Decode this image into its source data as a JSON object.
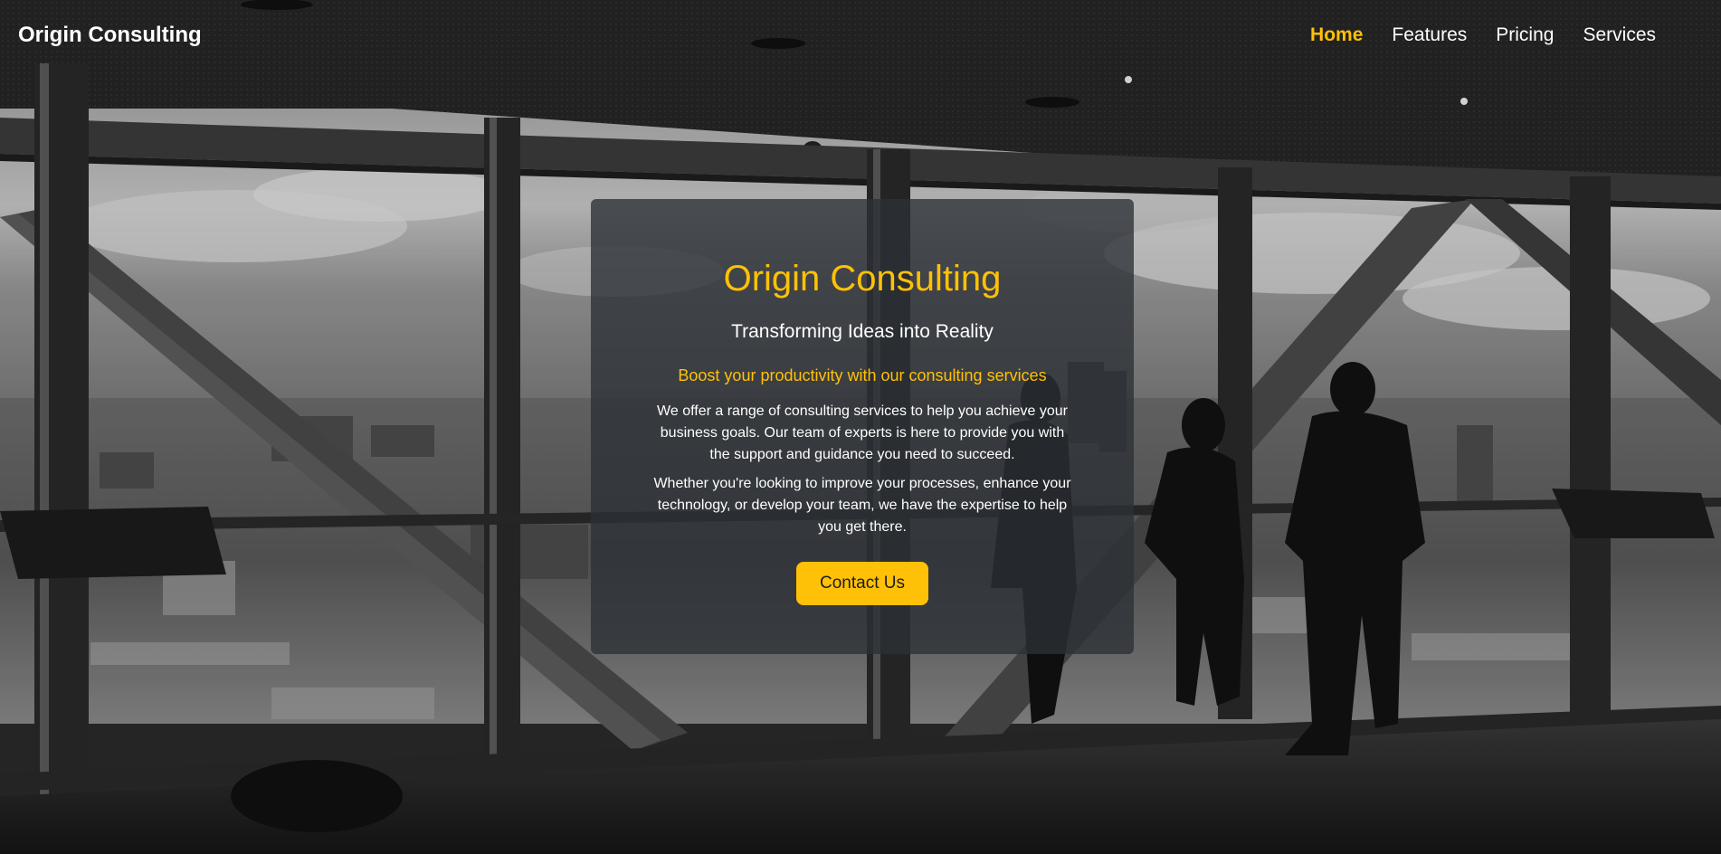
{
  "nav": {
    "brand": "Origin Consulting",
    "links": [
      {
        "label": "Home",
        "active": true
      },
      {
        "label": "Features",
        "active": false
      },
      {
        "label": "Pricing",
        "active": false
      },
      {
        "label": "Services",
        "active": false
      }
    ]
  },
  "hero": {
    "title": "Origin Consulting",
    "subtitle": "Transforming Ideas into Reality",
    "tagline": "Boost your productivity with our consulting services",
    "paragraph1": "We offer a range of consulting services to help you achieve your business goals. Our team of experts is here to provide you with the support and guidance you need to succeed.",
    "paragraph2": "Whether you're looking to improve your processes, enhance your technology, or develop your team, we have the expertise to help you get there.",
    "cta_label": "Contact Us"
  },
  "colors": {
    "accent": "#ffc107",
    "text": "#ffffff",
    "card_bg": "#2c2f34"
  }
}
